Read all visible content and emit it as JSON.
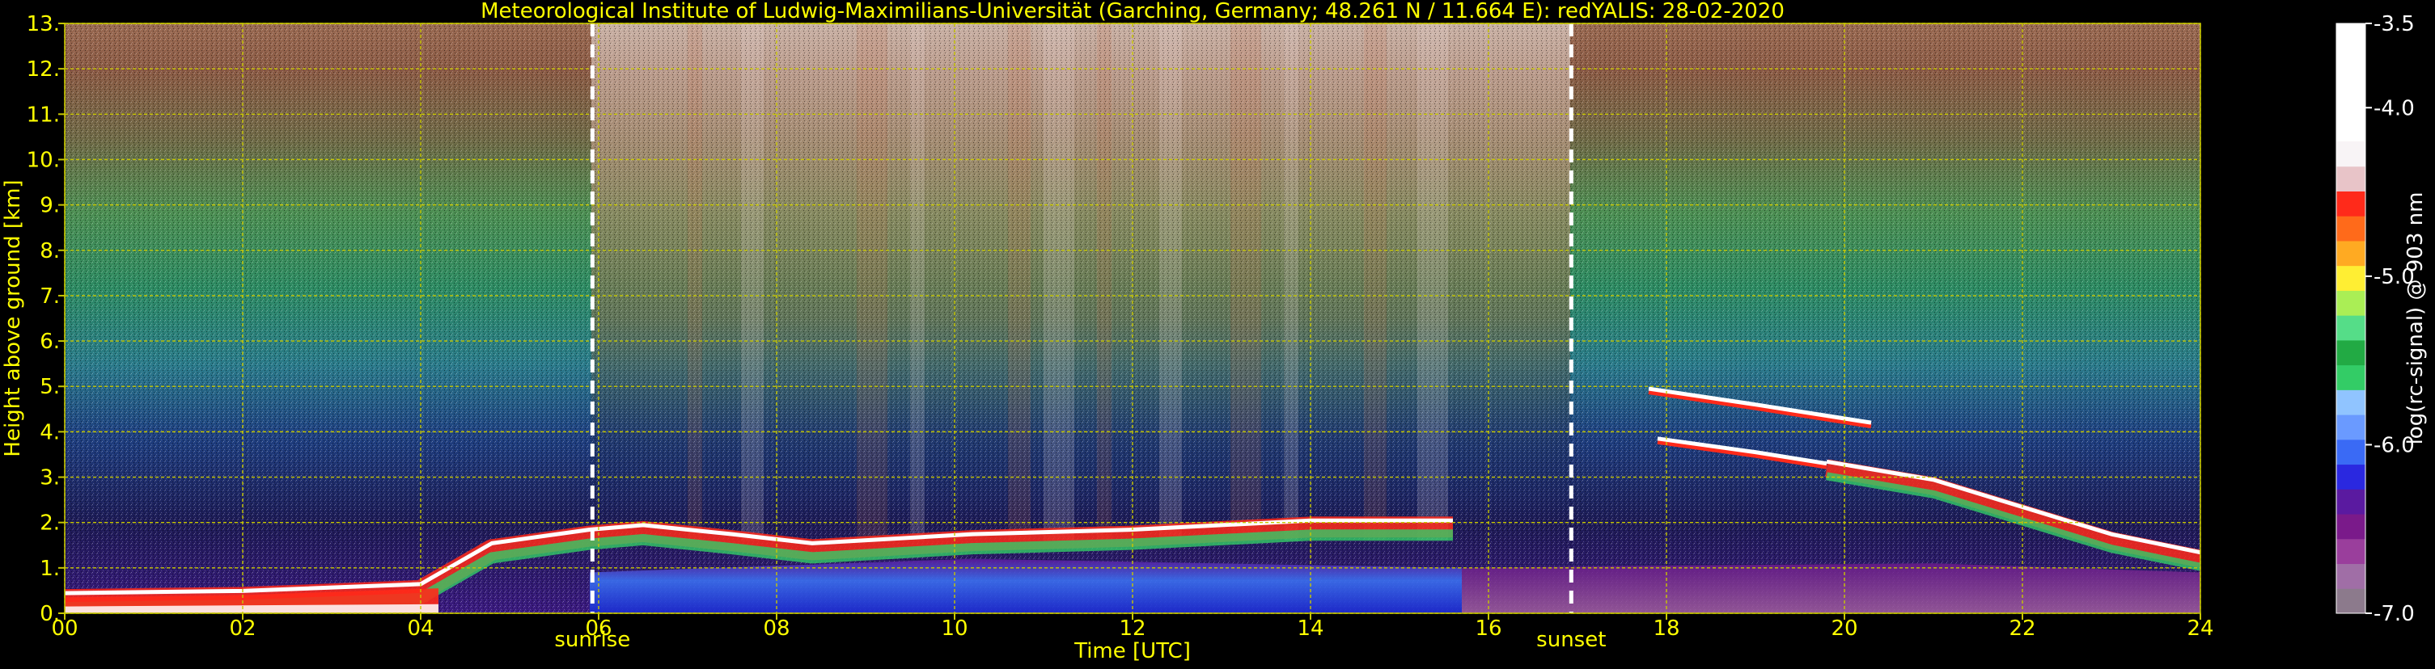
{
  "chart_data": {
    "type": "heatmap",
    "title": "Meteorological Institute of Ludwig-Maximilians-Universität (Garching, Germany; 48.261 N / 11.664 E):    redYALIS: 28-02-2020",
    "xlabel": "Time [UTC]",
    "ylabel": "Height above ground [km]",
    "colorbar_label": "log(rc-signal) @ 903 nm",
    "xlim": [
      0,
      24
    ],
    "ylim": [
      0,
      13
    ],
    "clim": [
      -7.0,
      -3.5
    ],
    "grid": true,
    "x_ticks": [
      0,
      2,
      4,
      6,
      8,
      10,
      12,
      14,
      16,
      18,
      20,
      22,
      24
    ],
    "x_tick_labels": [
      "00",
      "02",
      "04",
      "06",
      "08",
      "10",
      "12",
      "14",
      "16",
      "18",
      "20",
      "22",
      "24"
    ],
    "y_ticks": [
      0,
      1,
      2,
      3,
      4,
      5,
      6,
      7,
      8,
      9,
      10,
      11,
      12,
      13
    ],
    "y_tick_labels": [
      "0.",
      "1.",
      "2.",
      "3.",
      "4.",
      "5.",
      "6.",
      "7.",
      "8.",
      "9.",
      "10.",
      "11.",
      "12.",
      "13."
    ],
    "cbar_ticks": [
      -7.0,
      -6.0,
      -5.0,
      -4.0,
      -3.5
    ],
    "cbar_tick_labels": [
      "-7.0",
      "-6.0",
      "-5.0",
      "-4.0",
      "-3.5"
    ],
    "events": [
      {
        "label": "sunrise",
        "x": 5.93
      },
      {
        "label": "sunset",
        "x": 16.93
      }
    ],
    "features": [
      {
        "feature": "boundary layer top",
        "points": [
          [
            0.0,
            0.3
          ],
          [
            2.0,
            0.35
          ],
          [
            4.0,
            0.5
          ],
          [
            4.8,
            1.4
          ],
          [
            5.9,
            1.7
          ],
          [
            6.5,
            1.8
          ],
          [
            7.5,
            1.6
          ],
          [
            8.4,
            1.4
          ],
          [
            10.2,
            1.6
          ],
          [
            12.0,
            1.7
          ],
          [
            14.0,
            1.9
          ],
          [
            15.6,
            1.9
          ]
        ]
      },
      {
        "feature": "aerosol layer",
        "points": [
          [
            17.8,
            4.95
          ],
          [
            19.0,
            4.6
          ],
          [
            20.3,
            4.2
          ]
        ]
      },
      {
        "feature": "aerosol layer",
        "points": [
          [
            17.9,
            3.85
          ],
          [
            19.0,
            3.55
          ],
          [
            19.8,
            3.3
          ]
        ]
      },
      {
        "feature": "cloud",
        "points": [
          [
            19.8,
            3.2
          ],
          [
            21.0,
            2.8
          ],
          [
            22.0,
            2.2
          ],
          [
            23.0,
            1.6
          ],
          [
            24.0,
            1.2
          ]
        ]
      }
    ],
    "colors": {
      "background": "#000000",
      "text": "#ffff00",
      "grid": "#c8c800",
      "event_line": "#ffffff",
      "colorbar": [
        "#8c7a8c",
        "#a06ea6",
        "#9a3e9c",
        "#7a1a8a",
        "#5a1aa0",
        "#2a28e0",
        "#3a6af5",
        "#6a9aff",
        "#90c4ff",
        "#33cc66",
        "#22aa44",
        "#55dd88",
        "#aaee55",
        "#ffee33",
        "#ffaa22",
        "#ff6a1a",
        "#ff2a1a",
        "#e8c4c8",
        "#f8f4f6",
        "#ffffff"
      ]
    }
  }
}
